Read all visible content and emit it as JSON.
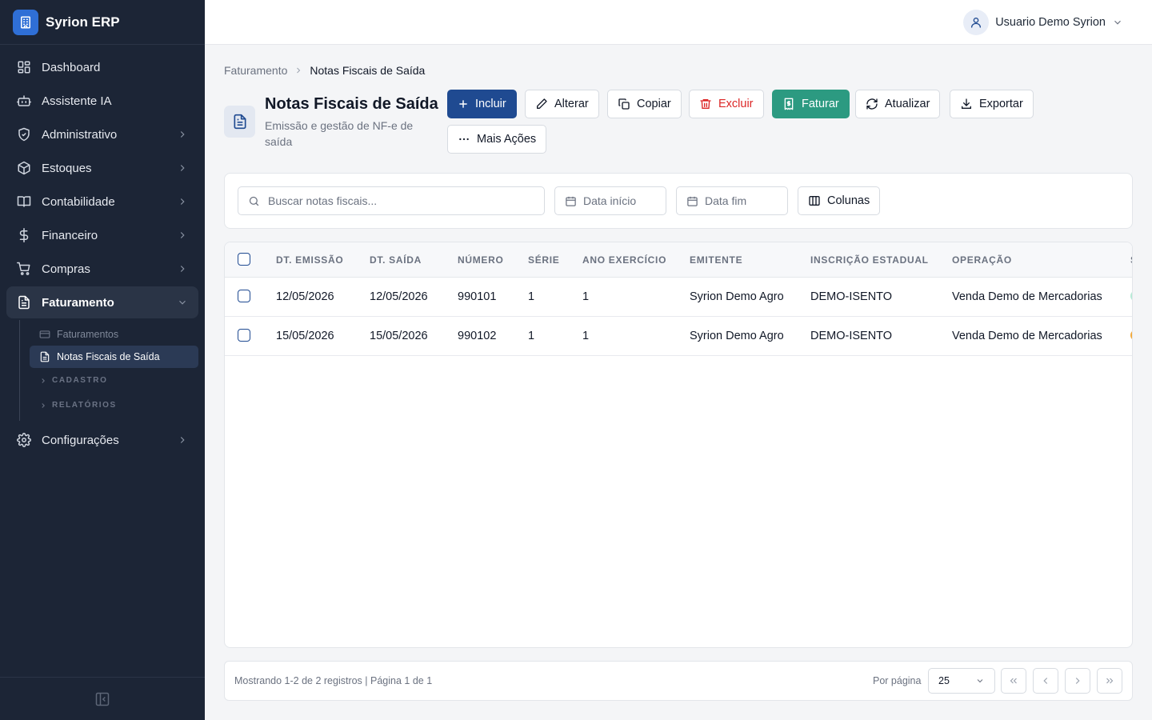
{
  "app": {
    "name": "Syrion ERP"
  },
  "colors": {
    "sidebar_bg": "#1c2536",
    "primary": "#1f4a91",
    "success": "#2c9a81",
    "danger": "#dc2626",
    "status_green": "#b7ead6",
    "status_amber": "#f2a93b"
  },
  "sidebar": {
    "items": [
      {
        "label": "Dashboard",
        "icon": "grid-icon"
      },
      {
        "label": "Assistente IA",
        "icon": "bot-icon"
      },
      {
        "label": "Administrativo",
        "icon": "shield-icon"
      },
      {
        "label": "Estoques",
        "icon": "box-icon"
      },
      {
        "label": "Contabilidade",
        "icon": "book-icon"
      },
      {
        "label": "Financeiro",
        "icon": "dollar-icon"
      },
      {
        "label": "Compras",
        "icon": "cart-icon"
      },
      {
        "label": "Faturamento",
        "icon": "document-icon"
      },
      {
        "label": "Configurações",
        "icon": "gear-icon"
      }
    ],
    "faturamento_sub": {
      "items": [
        {
          "label": "Faturamentos",
          "icon": "card-icon"
        },
        {
          "label": "Notas Fiscais de Saída",
          "icon": "document-icon"
        }
      ],
      "groups": [
        "CADASTRO",
        "RELATÓRIOS"
      ]
    }
  },
  "header": {
    "user_name": "Usuario Demo Syrion"
  },
  "breadcrumb": {
    "parent": "Faturamento",
    "current": "Notas Fiscais de Saída"
  },
  "page": {
    "title": "Notas Fiscais de Saída",
    "subtitle": "Emissão e gestão de NF-e de saída"
  },
  "toolbar": {
    "incluir": "Incluir",
    "alterar": "Alterar",
    "copiar": "Copiar",
    "excluir": "Excluir",
    "faturar": "Faturar",
    "atualizar": "Atualizar",
    "exportar": "Exportar",
    "mais_acoes": "Mais Ações"
  },
  "filters": {
    "search_placeholder": "Buscar notas fiscais...",
    "date_start_placeholder": "Data início",
    "date_end_placeholder": "Data fim",
    "columns_label": "Colunas"
  },
  "table": {
    "columns": [
      "DT. EMISSÃO",
      "DT. SAÍDA",
      "NÚMERO",
      "SÉRIE",
      "ANO EXERCÍCIO",
      "EMITENTE",
      "INSCRIÇÃO ESTADUAL",
      "OPERAÇÃO",
      "S"
    ],
    "rows": [
      {
        "dt_emissao": "12/05/2026",
        "dt_saida": "12/05/2026",
        "numero": "990101",
        "serie": "1",
        "ano_exercicio": "1",
        "emitente": "Syrion Demo Agro",
        "inscricao": "DEMO-ISENTO",
        "operacao": "Venda Demo de Mercadorias",
        "status_color": "#b7ead6"
      },
      {
        "dt_emissao": "15/05/2026",
        "dt_saida": "15/05/2026",
        "numero": "990102",
        "serie": "1",
        "ano_exercicio": "1",
        "emitente": "Syrion Demo Agro",
        "inscricao": "DEMO-ISENTO",
        "operacao": "Venda Demo de Mercadorias",
        "status_color": "#f2a93b"
      }
    ]
  },
  "pagination": {
    "info": "Mostrando 1-2 de 2 registros | Página 1 de 1",
    "per_page_label": "Por página",
    "per_page_value": "25"
  }
}
